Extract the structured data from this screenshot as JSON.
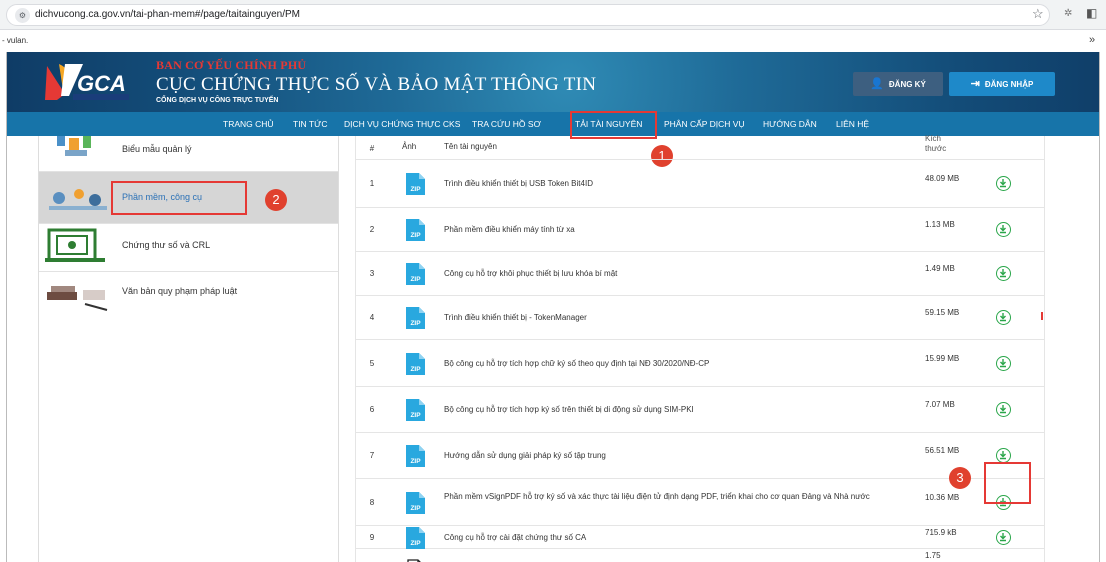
{
  "browser": {
    "url": "dichvucong.ca.gov.vn/tai-phan-mem#/page/taitainguyen/PM",
    "site_info_icon": "tune-icon",
    "bookmark_text": "- vulan.",
    "more_bookmarks": "»"
  },
  "banner": {
    "line1": "BAN CƠ YẾU CHÍNH PHỦ",
    "line2": "CỤC CHỨNG THỰC SỐ VÀ BẢO MẬT THÔNG TIN",
    "line3": "CỔNG DỊCH VỤ CÔNG TRỰC TUYẾN",
    "register": "ĐĂNG KÝ",
    "login": "ĐĂNG NHẬP"
  },
  "nav": [
    "TRANG CHỦ",
    "TIN TỨC",
    "DỊCH VỤ CHỨNG THỰC CKS",
    "TRA CỨU HỒ SƠ",
    "TẢI TÀI NGUYÊN",
    "PHÂN CẤP DỊCH VỤ",
    "HƯỚNG DẪN",
    "LIÊN HỆ"
  ],
  "callouts": [
    "1",
    "2",
    "3"
  ],
  "sidebar": [
    "Biểu mẫu quản lý",
    "Phần mềm, công cụ",
    "Chứng thư số và CRL",
    "Văn bản quy phạm pháp luật"
  ],
  "table": {
    "headers": [
      "#",
      "Ảnh",
      "Tên tài nguyên",
      "Kích thước"
    ],
    "rows": [
      {
        "num": "1",
        "name": "Trình điều khiển thiết bị USB Token Bit4ID",
        "size": "48.09 MB"
      },
      {
        "num": "2",
        "name": "Phần mềm điều khiển máy tính từ xa",
        "size": "1.13 MB"
      },
      {
        "num": "3",
        "name": "Công cụ hỗ trợ khôi phục thiết bị lưu khóa bí mật",
        "size": "1.49 MB"
      },
      {
        "num": "4",
        "name": "Trình điều khiển thiết bị - TokenManager",
        "size": "59.15 MB"
      },
      {
        "num": "5",
        "name": "Bộ công cụ hỗ trợ tích hợp chữ ký số theo quy định tại NĐ 30/2020/NĐ-CP",
        "size": "15.99 MB"
      },
      {
        "num": "6",
        "name": "Bộ công cụ hỗ trợ tích hợp ký số trên thiết bị di động sử dụng SIM-PKI",
        "size": "7.07 MB"
      },
      {
        "num": "7",
        "name": "Hướng dẫn sử dụng giải pháp ký số tập trung",
        "size": "56.51 MB"
      },
      {
        "num": "8",
        "name": "Phần mềm vSignPDF hỗ trợ ký số và xác thực tài liệu điện tử định dạng PDF, triển khai cho cơ quan Đảng và Nhà nước",
        "size": "10.36 MB"
      },
      {
        "num": "9",
        "name": "Công cụ hỗ trợ cài đặt chứng thư số CA",
        "size": "715.9 kB"
      },
      {
        "num": "",
        "name": "",
        "size": "1.75"
      }
    ],
    "zip_label": "ZIP"
  }
}
